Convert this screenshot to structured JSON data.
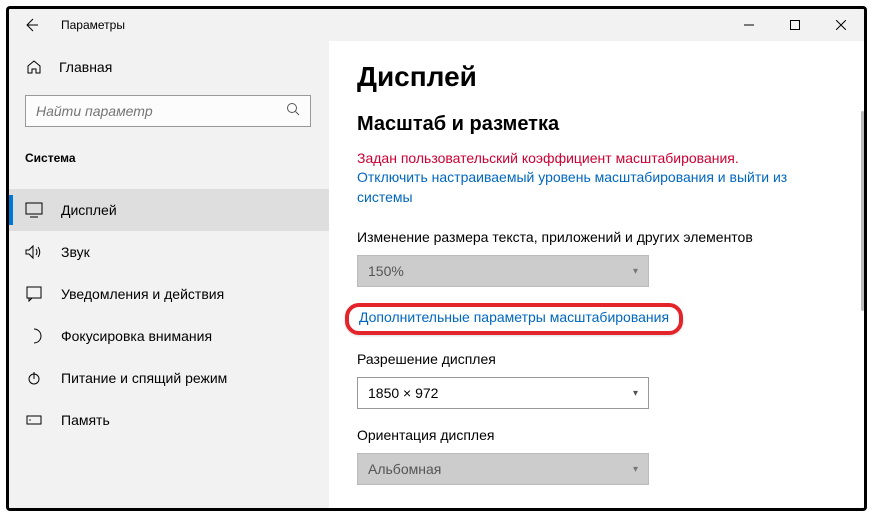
{
  "window": {
    "title": "Параметры"
  },
  "sidebar": {
    "home_label": "Главная",
    "search_placeholder": "Найти параметр",
    "section": "Система",
    "items": [
      {
        "label": "Дисплей",
        "icon": "display"
      },
      {
        "label": "Звук",
        "icon": "sound"
      },
      {
        "label": "Уведомления и действия",
        "icon": "notification"
      },
      {
        "label": "Фокусировка внимания",
        "icon": "focus"
      },
      {
        "label": "Питание и спящий режим",
        "icon": "power"
      },
      {
        "label": "Память",
        "icon": "storage"
      }
    ]
  },
  "content": {
    "heading": "Дисплей",
    "section_heading": "Масштаб и разметка",
    "warning_text": "Задан пользовательский коэффициент масштабирования.",
    "disable_link": "Отключить настраиваемый уровень масштабирования и выйти из системы",
    "scale_label": "Изменение размера текста, приложений и других элементов",
    "scale_value": "150%",
    "advanced_scaling": "Дополнительные параметры масштабирования",
    "resolution_label": "Разрешение дисплея",
    "resolution_value": "1850 × 972",
    "orientation_label": "Ориентация дисплея",
    "orientation_value": "Альбомная"
  }
}
